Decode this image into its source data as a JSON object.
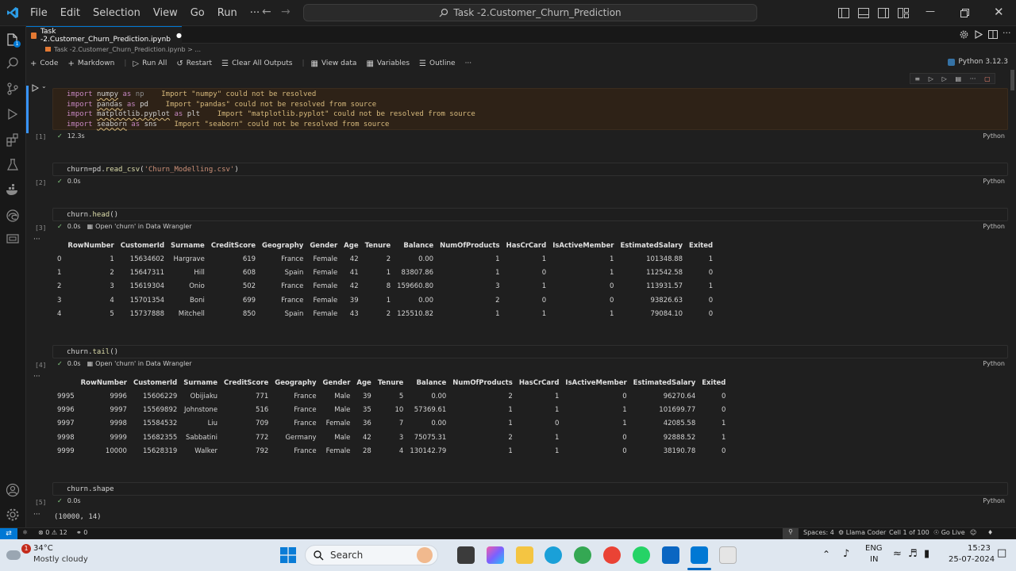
{
  "titlebar": {
    "menu": [
      "File",
      "Edit",
      "Selection",
      "View",
      "Go",
      "Run",
      "···"
    ],
    "search_text": "Task -2.Customer_Churn_Prediction"
  },
  "tab": {
    "label": "Task -2.Customer_Churn_Prediction.ipynb",
    "dirty_marker": "●"
  },
  "breadcrumb": "Task -2.Customer_Churn_Prediction.ipynb > ...",
  "toolbar": {
    "code": "Code",
    "markdown": "Markdown",
    "run_all": "Run All",
    "restart": "Restart",
    "clear_outputs": "Clear All Outputs",
    "view_data": "View data",
    "variables": "Variables",
    "outline": "Outline",
    "more": "···",
    "kernel": "Python 3.12.3"
  },
  "cells": {
    "c1": {
      "count": "[1]",
      "time": "12.3s",
      "lang": "Python",
      "lines": [
        {
          "mod": "numpy",
          "alias": "np",
          "warn": "Import \"numpy\" could not be resolved"
        },
        {
          "mod": "pandas",
          "alias": "pd",
          "warn": "Import \"pandas\" could not be resolved from source"
        },
        {
          "mod": "matplotlib.pyplot",
          "alias": "plt",
          "warn": "Import \"matplotlib.pyplot\" could not be resolved from source"
        },
        {
          "mod": "seaborn",
          "alias": "sns",
          "warn": "Import \"seaborn\" could not be resolved from source"
        }
      ],
      "kw_import": "import",
      "kw_as": "as"
    },
    "c2": {
      "count": "[2]",
      "time": "0.0s",
      "lang": "Python",
      "code_a": "churn=pd.",
      "code_fn": "read_csv",
      "code_b": "(",
      "code_str": "'Churn_Modelling.csv'",
      "code_c": ")"
    },
    "c3": {
      "count": "[3]",
      "time": "0.0s",
      "lang": "Python",
      "code_a": "churn.",
      "code_fn": "head",
      "code_c": "()",
      "wrangler": "Open 'churn' in Data Wrangler"
    },
    "c4": {
      "count": "[4]",
      "time": "0.0s",
      "lang": "Python",
      "code_a": "churn.",
      "code_fn": "tail",
      "code_c": "()",
      "wrangler": "Open 'churn' in Data Wrangler"
    },
    "c5": {
      "count": "[5]",
      "time": "0.0s",
      "lang": "Python",
      "code": "churn.shape",
      "output": "(10000, 14)"
    }
  },
  "table_columns": [
    "",
    "RowNumber",
    "CustomerId",
    "Surname",
    "CreditScore",
    "Geography",
    "Gender",
    "Age",
    "Tenure",
    "Balance",
    "NumOfProducts",
    "HasCrCard",
    "IsActiveMember",
    "EstimatedSalary",
    "Exited"
  ],
  "head_rows": [
    [
      "0",
      "1",
      "15634602",
      "Hargrave",
      "619",
      "France",
      "Female",
      "42",
      "2",
      "0.00",
      "1",
      "1",
      "1",
      "101348.88",
      "1"
    ],
    [
      "1",
      "2",
      "15647311",
      "Hill",
      "608",
      "Spain",
      "Female",
      "41",
      "1",
      "83807.86",
      "1",
      "0",
      "1",
      "112542.58",
      "0"
    ],
    [
      "2",
      "3",
      "15619304",
      "Onio",
      "502",
      "France",
      "Female",
      "42",
      "8",
      "159660.80",
      "3",
      "1",
      "0",
      "113931.57",
      "1"
    ],
    [
      "3",
      "4",
      "15701354",
      "Boni",
      "699",
      "France",
      "Female",
      "39",
      "1",
      "0.00",
      "2",
      "0",
      "0",
      "93826.63",
      "0"
    ],
    [
      "4",
      "5",
      "15737888",
      "Mitchell",
      "850",
      "Spain",
      "Female",
      "43",
      "2",
      "125510.82",
      "1",
      "1",
      "1",
      "79084.10",
      "0"
    ]
  ],
  "tail_rows": [
    [
      "9995",
      "9996",
      "15606229",
      "Obijiaku",
      "771",
      "France",
      "Male",
      "39",
      "5",
      "0.00",
      "2",
      "1",
      "0",
      "96270.64",
      "0"
    ],
    [
      "9996",
      "9997",
      "15569892",
      "Johnstone",
      "516",
      "France",
      "Male",
      "35",
      "10",
      "57369.61",
      "1",
      "1",
      "1",
      "101699.77",
      "0"
    ],
    [
      "9997",
      "9998",
      "15584532",
      "Liu",
      "709",
      "France",
      "Female",
      "36",
      "7",
      "0.00",
      "1",
      "0",
      "1",
      "42085.58",
      "1"
    ],
    [
      "9998",
      "9999",
      "15682355",
      "Sabbatini",
      "772",
      "Germany",
      "Male",
      "42",
      "3",
      "75075.31",
      "2",
      "1",
      "0",
      "92888.52",
      "1"
    ],
    [
      "9999",
      "10000",
      "15628319",
      "Walker",
      "792",
      "France",
      "Female",
      "28",
      "4",
      "130142.79",
      "1",
      "1",
      "0",
      "38190.78",
      "0"
    ]
  ],
  "statusbar": {
    "problems": "⊗ 0 ⚠ 12",
    "ports": "⚭ 0",
    "spaces": "Spaces: 4",
    "llama": "Llama Coder",
    "cell": "Cell 1 of 100",
    "golive": "Go Live"
  },
  "taskbar": {
    "weather_temp": "34°C",
    "weather_desc": "Mostly cloudy",
    "weather_badge": "1",
    "search": "Search",
    "lang1": "ENG",
    "lang2": "IN",
    "time": "15:23",
    "date": "25-07-2024"
  },
  "colors": {
    "accent": "#0078d4",
    "warning": "#d7ba7d",
    "success": "#89d185"
  }
}
